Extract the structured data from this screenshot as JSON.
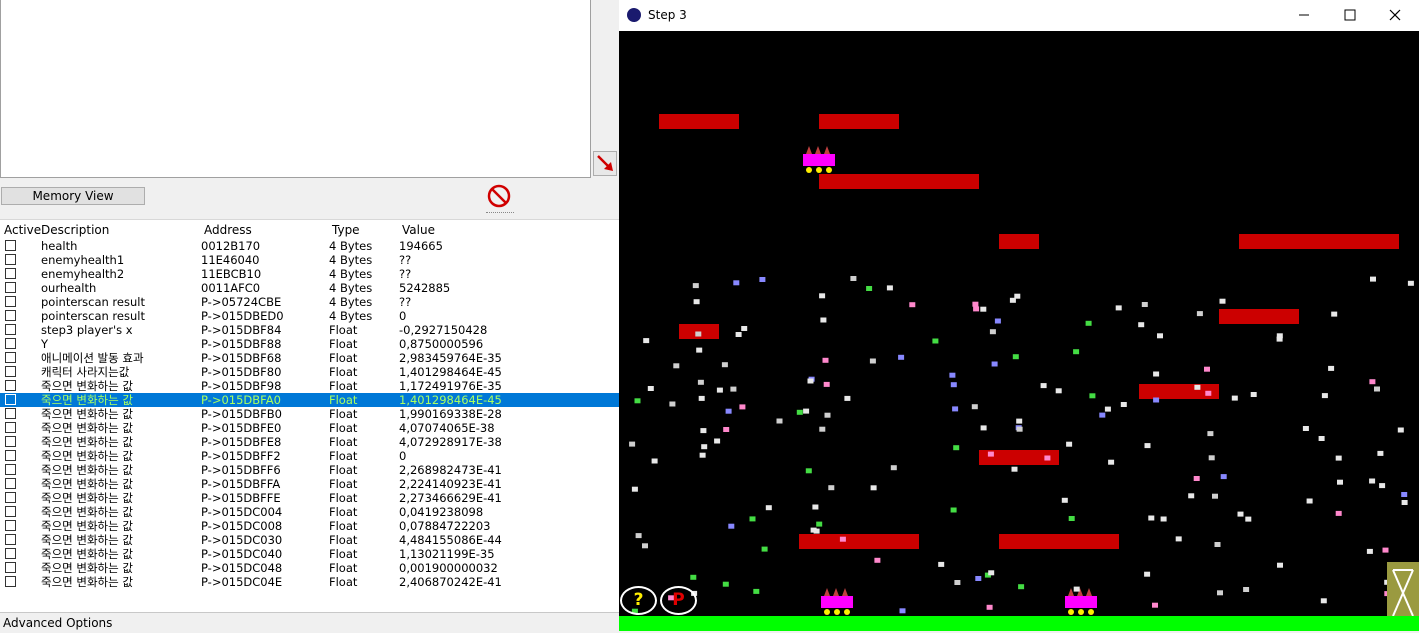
{
  "cheat_engine": {
    "memory_view_label": "Memory View",
    "advanced_options_label": "Advanced Options",
    "columns": [
      "Active",
      "Description",
      "Address",
      "Type",
      "Value"
    ],
    "rows": [
      {
        "desc": "health",
        "addr": "0012B170",
        "type": "4 Bytes",
        "value": "194665",
        "selected": false
      },
      {
        "desc": "enemyhealth1",
        "addr": "11E46040",
        "type": "4 Bytes",
        "value": "??",
        "selected": false
      },
      {
        "desc": "enemyhealth2",
        "addr": "11EBCB10",
        "type": "4 Bytes",
        "value": "??",
        "selected": false
      },
      {
        "desc": "ourhealth",
        "addr": "0011AFC0",
        "type": "4 Bytes",
        "value": "5242885",
        "selected": false
      },
      {
        "desc": "pointerscan result",
        "addr": "P->05724CBE",
        "type": "4 Bytes",
        "value": "??",
        "selected": false
      },
      {
        "desc": "pointerscan result",
        "addr": "P->015DBED0",
        "type": "4 Bytes",
        "value": "0",
        "selected": false
      },
      {
        "desc": "step3 player's x",
        "addr": "P->015DBF84",
        "type": "Float",
        "value": "-0,2927150428",
        "selected": false
      },
      {
        "desc": "Y",
        "addr": "P->015DBF88",
        "type": "Float",
        "value": "0,8750000596",
        "selected": false
      },
      {
        "desc": "애니메이션 발동 효과",
        "addr": "P->015DBF68",
        "type": "Float",
        "value": "2,983459764E-35",
        "selected": false
      },
      {
        "desc": "캐릭터 사라지는값",
        "addr": "P->015DBF80",
        "type": "Float",
        "value": "1,401298464E-45",
        "selected": false
      },
      {
        "desc": "죽으면 변화하는 값",
        "addr": "P->015DBF98",
        "type": "Float",
        "value": "1,172491976E-35",
        "selected": false
      },
      {
        "desc": "죽으면 변화하는 값",
        "addr": "P->015DBFA0",
        "type": "Float",
        "value": "1,401298464E-45",
        "selected": true
      },
      {
        "desc": "죽으면 변화하는 값",
        "addr": "P->015DBFB0",
        "type": "Float",
        "value": "1,990169338E-28",
        "selected": false
      },
      {
        "desc": "죽으면 변화하는 값",
        "addr": "P->015DBFE0",
        "type": "Float",
        "value": "4,07074065E-38",
        "selected": false
      },
      {
        "desc": "죽으면 변화하는 값",
        "addr": "P->015DBFE8",
        "type": "Float",
        "value": "4,072928917E-38",
        "selected": false
      },
      {
        "desc": "죽으면 변화하는 값",
        "addr": "P->015DBFF2",
        "type": "Float",
        "value": "0",
        "selected": false
      },
      {
        "desc": "죽으면 변화하는 값",
        "addr": "P->015DBFF6",
        "type": "Float",
        "value": "2,268982473E-41",
        "selected": false
      },
      {
        "desc": "죽으면 변화하는 값",
        "addr": "P->015DBFFA",
        "type": "Float",
        "value": "2,224140923E-41",
        "selected": false
      },
      {
        "desc": "죽으면 변화하는 값",
        "addr": "P->015DBFFE",
        "type": "Float",
        "value": "2,273466629E-41",
        "selected": false
      },
      {
        "desc": "죽으면 변화하는 값",
        "addr": "P->015DC004",
        "type": "Float",
        "value": "0,0419238098",
        "selected": false
      },
      {
        "desc": "죽으면 변화하는 값",
        "addr": "P->015DC008",
        "type": "Float",
        "value": "0,07884722203",
        "selected": false
      },
      {
        "desc": "죽으면 변화하는 값",
        "addr": "P->015DC030",
        "type": "Float",
        "value": "4,484155086E-44",
        "selected": false
      },
      {
        "desc": "죽으면 변화하는 값",
        "addr": "P->015DC040",
        "type": "Float",
        "value": "1,13021199E-35",
        "selected": false
      },
      {
        "desc": "죽으면 변화하는 값",
        "addr": "P->015DC048",
        "type": "Float",
        "value": "0,001900000032",
        "selected": false
      },
      {
        "desc": "죽으면 변화하는 값",
        "addr": "P->015DC04E",
        "type": "Float",
        "value": "2,406870242E-41",
        "selected": false
      }
    ]
  },
  "game_window": {
    "title": "Step 3",
    "help_label": "?",
    "pause_label": "P",
    "colors": {
      "platform": "#cc0000",
      "ground": "#00ff00",
      "background": "#000000",
      "player": "#ff00ff"
    }
  }
}
